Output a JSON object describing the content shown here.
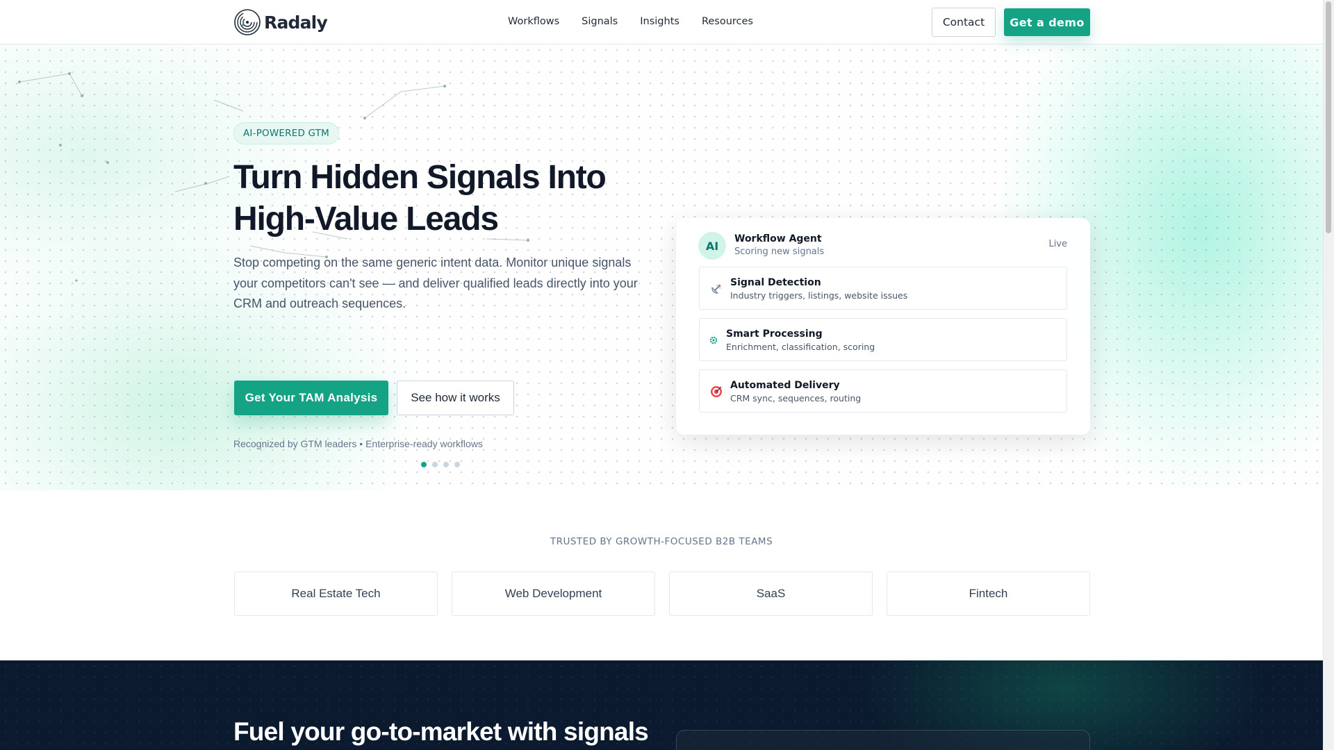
{
  "brand": {
    "name": "Radaly",
    "logo_icon": "radar-logo-icon"
  },
  "nav": {
    "items": [
      "Workflows",
      "Signals",
      "Insights",
      "Resources"
    ]
  },
  "header": {
    "contact_label": "Contact",
    "demo_label": "Get a demo"
  },
  "hero": {
    "badge": "AI-POWERED GTM",
    "title_line1": "Turn Hidden Signals Into",
    "title_line2": "High-Value Leads",
    "subtitle": "Stop competing on the same generic intent data. Monitor unique signals your competitors can't see — and deliver qualified leads directly into your CRM and outreach sequences.",
    "primary_cta": "Get Your TAM Analysis",
    "secondary_cta": "See how it works",
    "recognized": "Recognized by GTM leaders • Enterprise-ready workflows",
    "carousel": {
      "slides": 4,
      "active_index": 0
    }
  },
  "agent": {
    "avatar": "AI",
    "title": "Workflow Agent",
    "status": "Scoring new signals",
    "live": "Live",
    "steps": [
      {
        "icon": "satellite-dish-icon",
        "title": "Signal Detection",
        "desc": "Industry triggers, listings, website issues"
      },
      {
        "icon": "gear-icon",
        "title": "Smart Processing",
        "desc": "Enrichment, classification, scoring"
      },
      {
        "icon": "target-icon",
        "title": "Automated Delivery",
        "desc": "CRM sync, sequences, routing"
      }
    ]
  },
  "trusted": {
    "label": "TRUSTED BY GROWTH-FOCUSED B2B TEAMS",
    "industries": [
      "Real Estate Tech",
      "Web Development",
      "SaaS",
      "Fintech"
    ]
  },
  "section2": {
    "title": "Fuel your go-to-market with signals"
  },
  "colors": {
    "accent": "#15a385",
    "dark_bg": "#0b1a2e",
    "badge_bg": "#e7f7f1",
    "text": "#111827",
    "muted": "#64748b"
  }
}
